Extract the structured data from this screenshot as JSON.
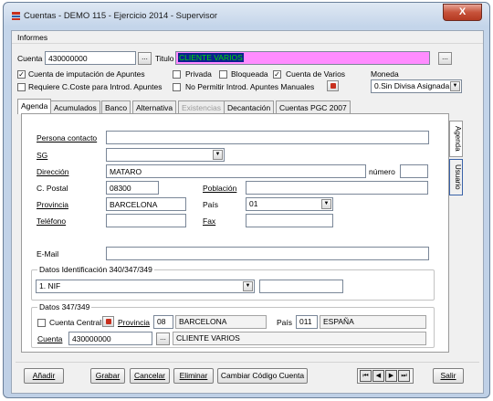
{
  "window": {
    "title": "Cuentas - DEMO 115 - Ejercicio 2014 - Supervisor",
    "close": "X"
  },
  "menu": {
    "informes": "Informes"
  },
  "header": {
    "cuenta_label": "Cuenta",
    "cuenta_value": "430000000",
    "dots": "...",
    "titulo_label": "Titulo",
    "titulo_value": "CLIENTE VARIOS",
    "imputacion": "Cuenta de imputación de Apuntes",
    "privada": "Privada",
    "bloqueada": "Bloqueada",
    "varios": "Cuenta de Varios",
    "moneda_label": "Moneda",
    "requiere": "Requiere C.Coste para Introd. Apuntes",
    "no_permitir": "No Permitir Introd. Apuntes Manuales",
    "moneda_value": "0.Sin Divisa Asignada",
    "checks": {
      "imputacion": true,
      "privada": false,
      "bloqueada": false,
      "varios": true,
      "requiere": false,
      "no_permitir": false
    }
  },
  "tabs": [
    "Agenda",
    "Acumulados",
    "Banco",
    "Alternativa",
    "Existencias",
    "Decantación",
    "Cuentas PGC 2007"
  ],
  "side_tabs": [
    "Agenda",
    "Usuario"
  ],
  "agenda": {
    "persona": "Persona contacto",
    "sg": "SG",
    "direccion": "Dirección",
    "direccion_value": "MATARO",
    "numero": "número",
    "cpostal": "C. Postal",
    "cpostal_value": "08300",
    "poblacion": "Población",
    "provincia": "Provincia",
    "provincia_value": "BARCELONA",
    "pais": "País",
    "pais_value": "01",
    "telefono": "Teléfono",
    "fax": "Fax",
    "email": "E-Mail",
    "g340": "Datos Identificación 340/347/349",
    "nif_value": "1. NIF",
    "g347": "Datos 347/349",
    "central": "Cuenta Central",
    "prov_label": "Provincia",
    "prov_code": "08",
    "prov_name": "BARCELONA",
    "pais_label": "País",
    "pais_code": "011",
    "pais_name": "ESPAÑA",
    "cuenta_label": "Cuenta",
    "cuenta_value": "430000000",
    "cuenta_name": "CLIENTE VARIOS"
  },
  "buttons": {
    "anadir": "Añadir",
    "grabar": "Grabar",
    "cancelar": "Cancelar",
    "eliminar": "Eliminar",
    "cambiar": "Cambiar Código Cuenta",
    "salir": "Salir"
  },
  "nav": [
    "⏮",
    "◀",
    "▶",
    "⏭"
  ],
  "colors": {
    "titulo_bg": "#ff8cff",
    "titulo_text": "#00c000",
    "titulo_sel": "#0a1f8f"
  }
}
